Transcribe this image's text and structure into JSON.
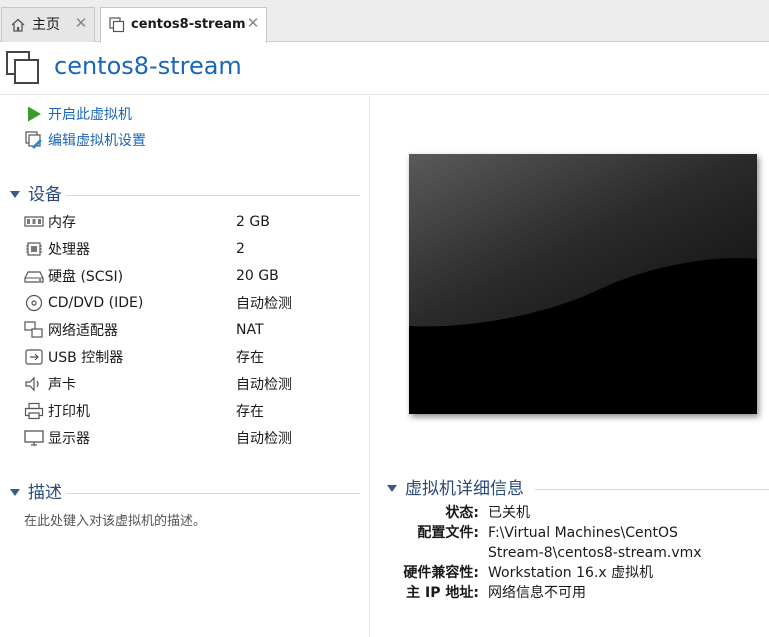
{
  "tabs": [
    {
      "label": "主页",
      "icon": "home-icon"
    },
    {
      "label": "centos8-stream",
      "icon": "vm-icon"
    }
  ],
  "header": {
    "title": "centos8-stream"
  },
  "actions": [
    {
      "label": "开启此虚拟机",
      "icon": "play-icon"
    },
    {
      "label": "编辑虚拟机设置",
      "icon": "edit-settings-icon"
    }
  ],
  "devices": {
    "title": "设备",
    "items": [
      {
        "name": "内存",
        "value": "2 GB",
        "icon": "memory-icon"
      },
      {
        "name": "处理器",
        "value": "2",
        "icon": "cpu-icon"
      },
      {
        "name": "硬盘 (SCSI)",
        "value": "20 GB",
        "icon": "hard-disk-icon"
      },
      {
        "name": "CD/DVD (IDE)",
        "value": "自动检测",
        "icon": "cd-dvd-icon"
      },
      {
        "name": "网络适配器",
        "value": "NAT",
        "icon": "network-adapter-icon"
      },
      {
        "name": "USB 控制器",
        "value": "存在",
        "icon": "usb-icon"
      },
      {
        "name": "声卡",
        "value": "自动检测",
        "icon": "sound-card-icon"
      },
      {
        "name": "打印机",
        "value": "存在",
        "icon": "printer-icon"
      },
      {
        "name": "显示器",
        "value": "自动检测",
        "icon": "display-icon"
      }
    ]
  },
  "description": {
    "title": "描述",
    "placeholder": "在此处键入对该虚拟机的描述。"
  },
  "details": {
    "title": "虚拟机详细信息",
    "status_label": "状态:",
    "status_value": "已关机",
    "config_label": "配置文件:",
    "config_value_line1": "F:\\Virtual Machines\\CentOS",
    "config_value_line2": "Stream-8\\centos8-stream.vmx",
    "compat_label": "硬件兼容性:",
    "compat_value": "Workstation 16.x 虚拟机",
    "ip_label": "主 IP 地址:",
    "ip_value": "网络信息不可用"
  },
  "colors": {
    "link": "#1a66b8",
    "section": "#2a4a7a",
    "play": "#3a9a2a"
  }
}
